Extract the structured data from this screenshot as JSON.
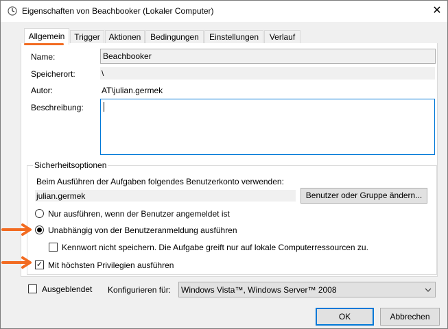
{
  "window": {
    "title": "Eigenschaften von Beachbooker (Lokaler Computer)",
    "close_glyph": "✕"
  },
  "tabs": [
    {
      "label": "Allgemein"
    },
    {
      "label": "Trigger"
    },
    {
      "label": "Aktionen"
    },
    {
      "label": "Bedingungen"
    },
    {
      "label": "Einstellungen"
    },
    {
      "label": "Verlauf"
    }
  ],
  "general": {
    "name_label": "Name:",
    "name_value": "Beachbooker",
    "location_label": "Speicherort:",
    "location_value": "\\",
    "author_label": "Autor:",
    "author_value": "AT\\julian.germek",
    "description_label": "Beschreibung:",
    "description_value": ""
  },
  "security": {
    "title": "Sicherheitsoptionen",
    "account_prompt": "Beim Ausführen der Aufgaben folgendes Benutzerkonto verwenden:",
    "account_value": "julian.germek",
    "change_button": "Benutzer oder Gruppe ändern...",
    "radio_logged_on": "Nur ausführen, wenn der Benutzer angemeldet ist",
    "radio_independent": "Unabhängig von der Benutzeranmeldung ausführen",
    "radio_selected": "independent",
    "no_password_label": "Kennwort nicht speichern. Die Aufgabe greift nur auf lokale Computerressourcen zu.",
    "no_password_checked": false,
    "highest_priv_label": "Mit höchsten Privilegien ausführen",
    "highest_priv_checked": true
  },
  "footer": {
    "hidden_label": "Ausgeblendet",
    "hidden_checked": false,
    "configure_label": "Konfigurieren für:",
    "configure_value": "Windows Vista™, Windows Server™ 2008",
    "ok_button": "OK",
    "cancel_button": "Abbrechen"
  },
  "colors": {
    "annotation": "#f26b21",
    "accent": "#0078d7"
  },
  "icons": {
    "title_icon": "clock-icon",
    "check_glyph": "✓"
  }
}
